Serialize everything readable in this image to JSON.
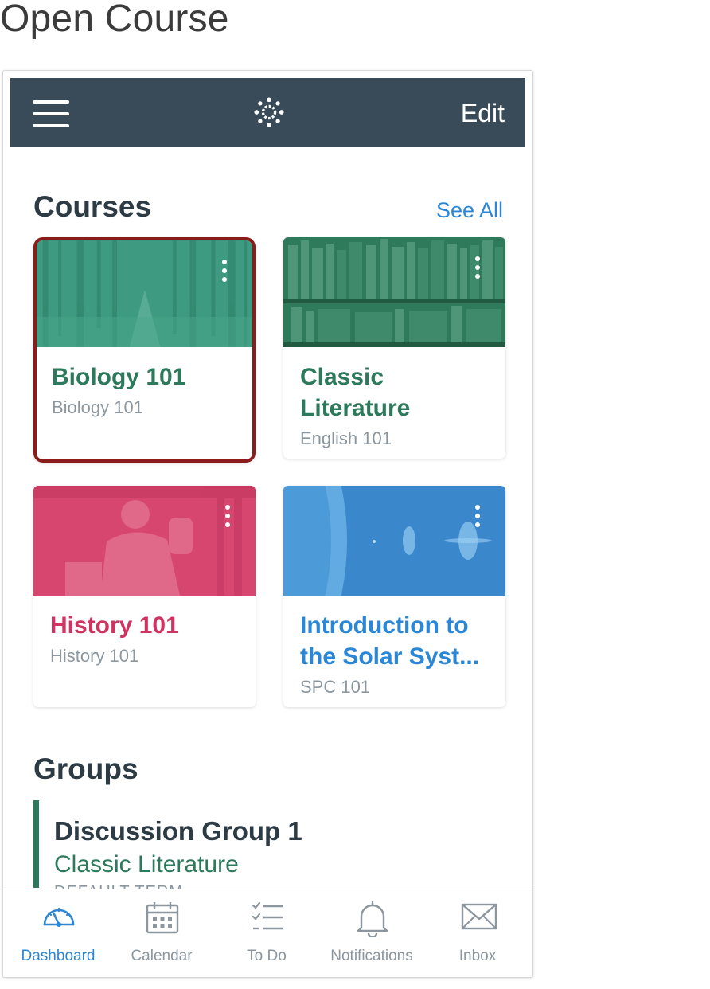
{
  "heading": "Open Course",
  "navbar": {
    "edit_label": "Edit"
  },
  "courses": {
    "title": "Courses",
    "see_all": "See All",
    "cards": [
      {
        "title_lines": [
          "Biology 101"
        ],
        "subtitle": "Biology 101",
        "color": "#2c7a5b",
        "selected": true
      },
      {
        "title_lines": [
          "Classic",
          "Literature"
        ],
        "subtitle": "English 101",
        "color": "#2c7a5b"
      },
      {
        "title_lines": [
          "History 101"
        ],
        "subtitle": "History 101",
        "color": "#d0335f"
      },
      {
        "title_lines": [
          "Introduction to",
          "the Solar Syst..."
        ],
        "subtitle": "SPC 101",
        "color": "#2b87d5"
      }
    ]
  },
  "groups": {
    "title": "Groups",
    "items": [
      {
        "name": "Discussion Group 1",
        "course": "Classic Literature",
        "term": "DEFAULT TERM",
        "color": "#2c7a5b"
      }
    ]
  },
  "tabbar": {
    "tabs": [
      {
        "label": "Dashboard",
        "icon": "dashboard-icon",
        "active": true
      },
      {
        "label": "Calendar",
        "icon": "calendar-icon"
      },
      {
        "label": "To Do",
        "icon": "todo-list-icon"
      },
      {
        "label": "Notifications",
        "icon": "bell-icon"
      },
      {
        "label": "Inbox",
        "icon": "envelope-icon"
      }
    ]
  },
  "colors": {
    "navbar": "#394b58",
    "highlight_border": "#8b1c1c",
    "link_blue": "#2b87d5",
    "biology_green": "#2c7a5b",
    "history_pink": "#d0335f",
    "solar_blue": "#2b87d5"
  }
}
